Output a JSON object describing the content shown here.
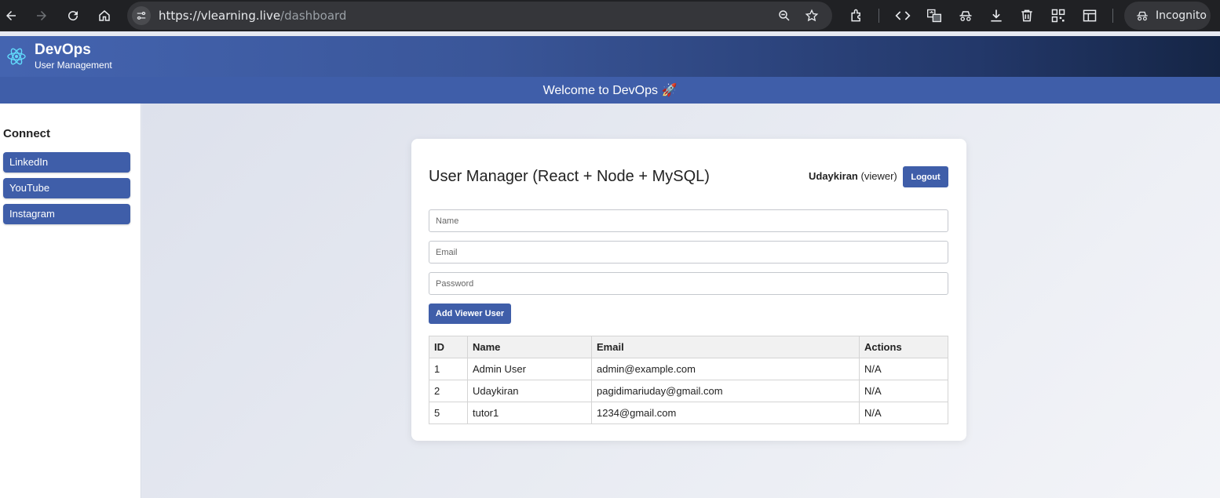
{
  "browser": {
    "url_host": "https://vlearning.live",
    "url_path": "/dashboard",
    "incognito_label": "Incognito"
  },
  "header": {
    "brand": "DevOps",
    "subtitle": "User Management",
    "welcome": "Welcome to DevOps 🚀"
  },
  "sidebar": {
    "heading": "Connect",
    "links": [
      {
        "label": "LinkedIn"
      },
      {
        "label": "YouTube"
      },
      {
        "label": "Instagram"
      }
    ]
  },
  "card": {
    "title": "User Manager (React + Node + MySQL)",
    "username": "Udaykiran",
    "role": "(viewer)",
    "logout_label": "Logout",
    "name_placeholder": "Name",
    "email_placeholder": "Email",
    "password_placeholder": "Password",
    "add_label": "Add Viewer User"
  },
  "table": {
    "columns": [
      "ID",
      "Name",
      "Email",
      "Actions"
    ],
    "rows": [
      {
        "id": "1",
        "name": "Admin User",
        "email": "admin@example.com",
        "actions": "N/A"
      },
      {
        "id": "2",
        "name": "Udaykiran",
        "email": "pagidimariuday@gmail.com",
        "actions": "N/A"
      },
      {
        "id": "5",
        "name": "tutor1",
        "email": "1234@gmail.com",
        "actions": "N/A"
      }
    ]
  },
  "colors": {
    "accent": "#3f5ea9",
    "chrome": "#202124"
  }
}
